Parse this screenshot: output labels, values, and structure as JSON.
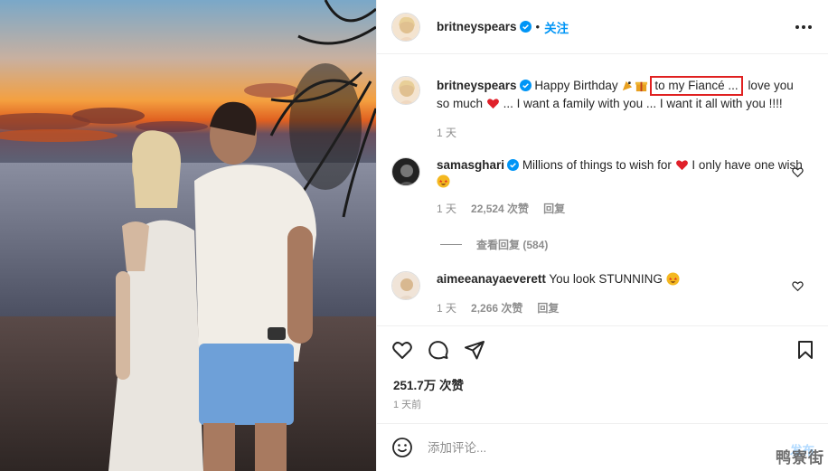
{
  "post": {
    "author": "britneyspears",
    "follow_label": "关注",
    "dot": "•",
    "caption": {
      "author": "britneyspears",
      "part1": "Happy Birthday",
      "highlight": "to my Fiancé ...",
      "part2": "love you so much",
      "part3": "... I want a family with you ... I want it all with you !!!!",
      "time": "1 天"
    },
    "comments": [
      {
        "author": "samasghari",
        "text1": "Millions of things to wish for",
        "text2": "I only have one wish",
        "time": "1 天",
        "likes": "22,524 次赞",
        "reply": "回复"
      },
      {
        "author": "aimeeanayaeverett",
        "text1": "You look STUNNING",
        "time": "1 天",
        "likes": "2,266 次赞",
        "reply": "回复"
      }
    ],
    "view_replies": "查看回复 (584)",
    "likes_count": "251.7万 次赞",
    "posted_time": "1 天前",
    "add_comment_placeholder": "添加评论...",
    "post_button": "发布",
    "watermark": "鸭寮街"
  },
  "colors": {
    "accent": "#0095f6",
    "verified": "#0095f6",
    "highlight_border": "#e02020",
    "meta_text": "#8e8e8e"
  },
  "icons": {
    "like": "heart-icon",
    "comment": "comment-icon",
    "share": "paper-plane-icon",
    "save": "bookmark-icon",
    "emoji": "smiley-icon",
    "more": "more-icon",
    "verified": "verified-badge-icon"
  }
}
